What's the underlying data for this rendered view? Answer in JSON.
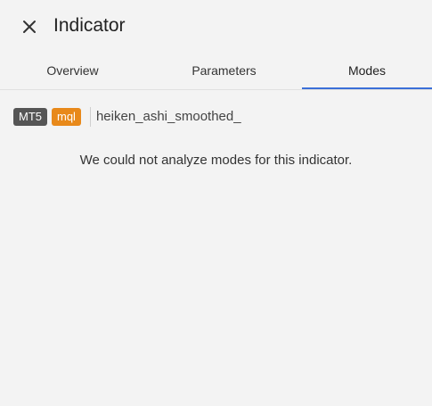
{
  "header": {
    "title": "Indicator"
  },
  "tabs": [
    {
      "label": "Overview",
      "active": false
    },
    {
      "label": "Parameters",
      "active": false
    },
    {
      "label": "Modes",
      "active": true
    }
  ],
  "meta": {
    "platform": "MT5",
    "language": "mql",
    "indicator_name": "heiken_ashi_smoothed_"
  },
  "modes": {
    "message": "We could not analyze modes for this indicator."
  },
  "colors": {
    "accent": "#3b6fd8",
    "platform_badge": "#555555",
    "language_badge": "#e8891a",
    "background": "#f3f3f3"
  },
  "icons": {
    "close": "close-icon"
  }
}
